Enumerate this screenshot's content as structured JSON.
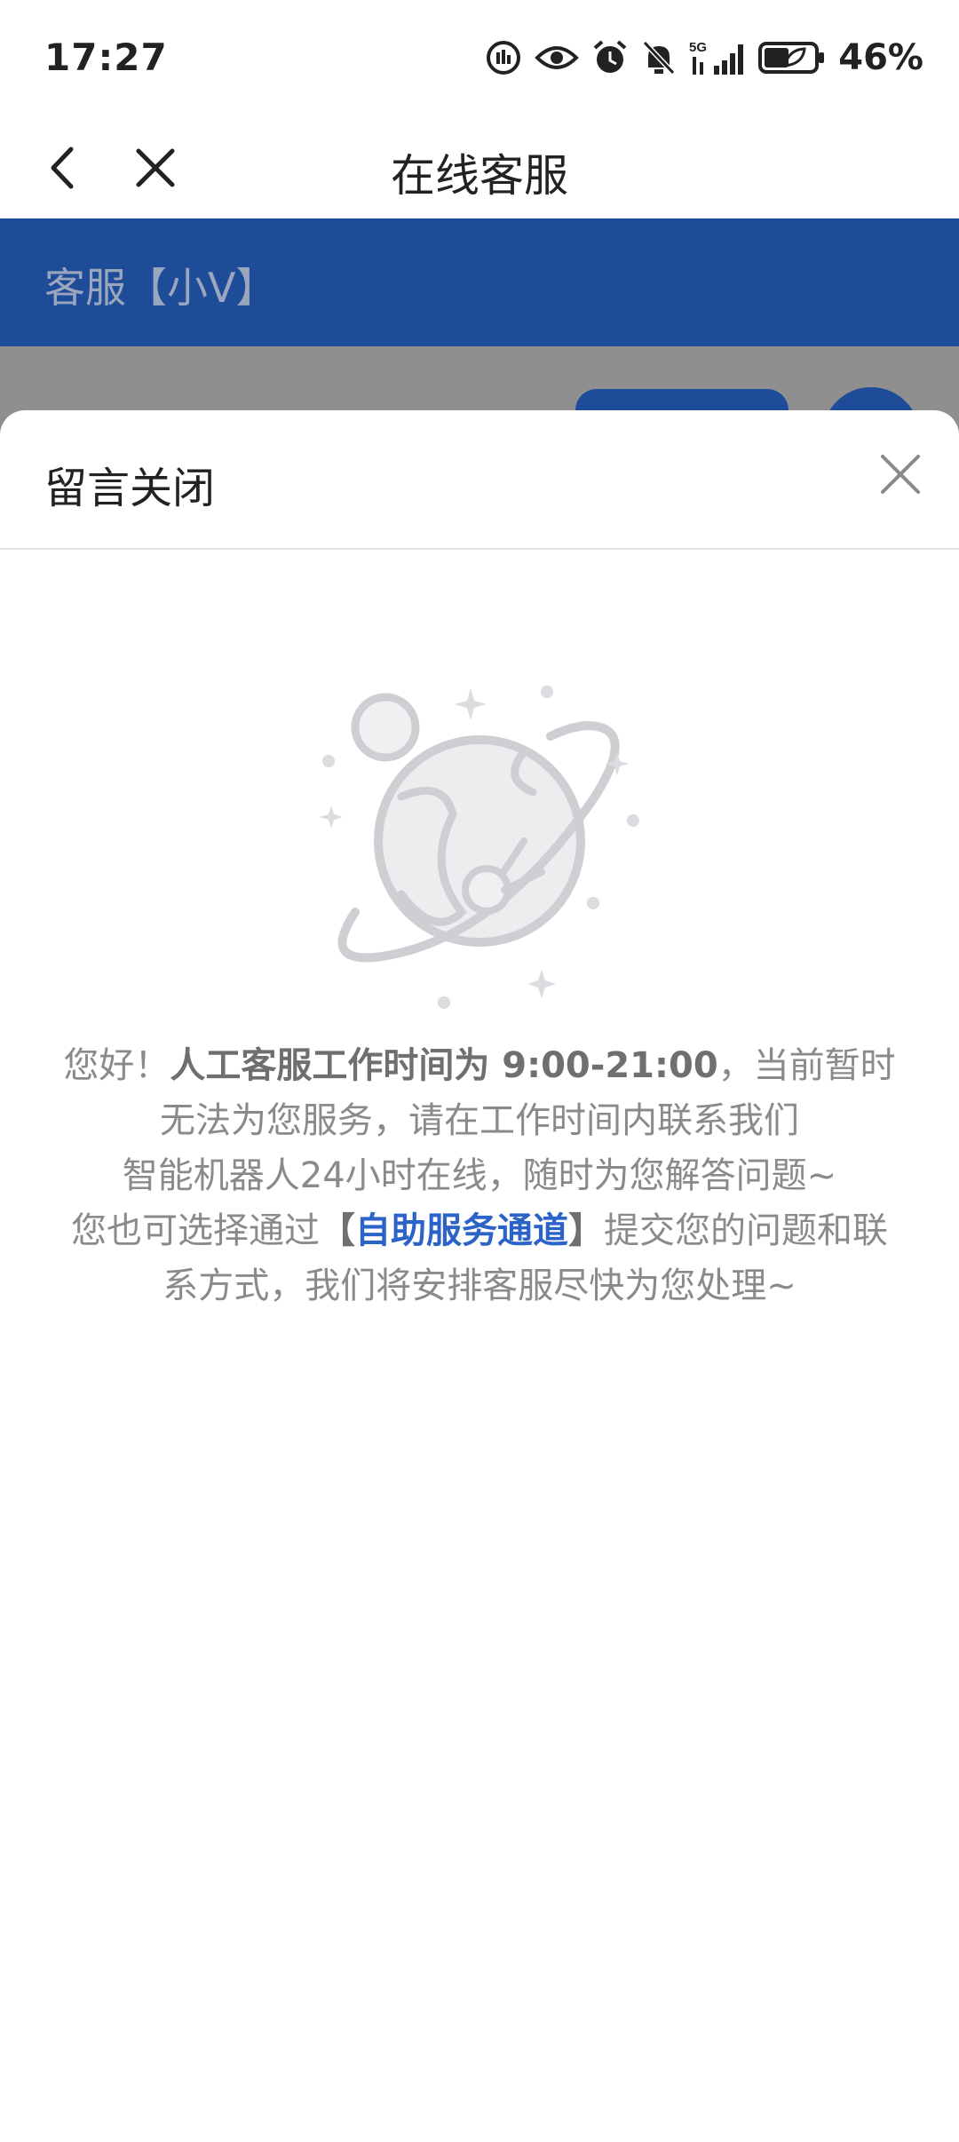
{
  "status_bar": {
    "time": "17:27",
    "icons": [
      "data-saver-icon",
      "eye-icon",
      "alarm-icon",
      "bell-muted-icon",
      "signal-5g-icon",
      "battery-leaf-icon"
    ],
    "network": "5G",
    "battery": "46%"
  },
  "nav": {
    "title": "在线客服",
    "back_icon": "chevron-left-icon",
    "close_icon": "close-icon"
  },
  "agent": {
    "name": "客服【小V】"
  },
  "sheet": {
    "title": "留言关闭",
    "close_icon": "close-icon",
    "illustration": "planet-empty-state-icon",
    "message": {
      "greeting": "您好！",
      "hours": "人工客服工作时间为 9:00-21:00",
      "line1_rest": "，当前暂时",
      "line2": "无法为您服务，请在工作时间内联系我们",
      "line3": "智能机器人24小时在线，随时为您解答问题~",
      "line4_pre": "您也可选择通过",
      "bracket_open": "【",
      "link": "自助服务通道",
      "bracket_close": "】",
      "line4_post": "提交您的问题和联",
      "line5": "系方式，我们将安排客服尽快为您处理~"
    }
  },
  "colors": {
    "brand_blue": "#1f4c99",
    "link_blue": "#2c63c9",
    "overlay_gray": "#8f8f8f"
  }
}
